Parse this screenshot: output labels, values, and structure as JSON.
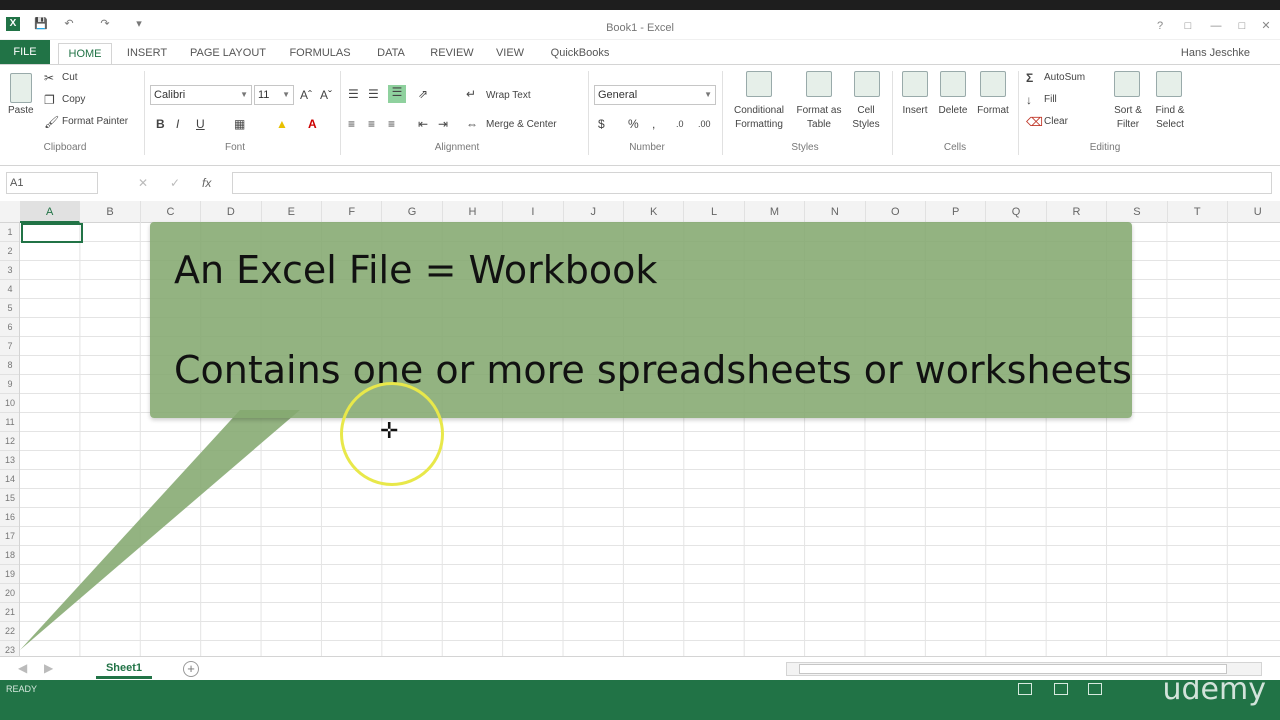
{
  "window": {
    "title": "Book1 - Excel",
    "user": "Hans Jeschke"
  },
  "tabs": [
    "FILE",
    "HOME",
    "INSERT",
    "PAGE LAYOUT",
    "FORMULAS",
    "DATA",
    "REVIEW",
    "VIEW",
    "QuickBooks"
  ],
  "ribbon": {
    "clipboard": {
      "paste": "Paste",
      "cut": "Cut",
      "copy": "Copy",
      "format_painter": "Format Painter",
      "label": "Clipboard"
    },
    "font": {
      "name": "Calibri",
      "size": "11",
      "bold": "B",
      "italic": "I",
      "underline": "U",
      "label": "Font"
    },
    "alignment": {
      "wrap_text": "Wrap Text",
      "merge_center": "Merge & Center",
      "label": "Alignment"
    },
    "number": {
      "format": "General",
      "currency": "$",
      "percent": "%",
      "label": "Number"
    },
    "styles": {
      "conditional": "Conditional",
      "conditional2": "Formatting",
      "format_as": "Format as",
      "format_as2": "Table",
      "cell": "Cell",
      "cell2": "Styles",
      "label": "Styles"
    },
    "cells": {
      "insert": "Insert",
      "delete": "Delete",
      "format": "Format",
      "label": "Cells"
    },
    "editing": {
      "autosum": "AutoSum",
      "fill": "Fill",
      "clear": "Clear",
      "sort": "Sort &",
      "sort2": "Filter",
      "find": "Find &",
      "find2": "Select",
      "label": "Editing"
    }
  },
  "formula_bar": {
    "namebox": "A1",
    "fx": "fx"
  },
  "columns": [
    "A",
    "B",
    "C",
    "D",
    "E",
    "F",
    "G",
    "H",
    "I",
    "J",
    "K",
    "L",
    "M",
    "N",
    "O",
    "P",
    "Q",
    "R",
    "S",
    "T",
    "U"
  ],
  "rows": [
    "1",
    "2",
    "3",
    "4",
    "5",
    "6",
    "7",
    "8",
    "9",
    "10",
    "11",
    "12",
    "13",
    "14",
    "15",
    "16",
    "17",
    "18",
    "19",
    "20",
    "21",
    "22",
    "23"
  ],
  "callout": {
    "line1": "An Excel File = Workbook",
    "line2": "Contains one or more spreadsheets or worksheets"
  },
  "sheets": {
    "active": "Sheet1"
  },
  "status": {
    "ready": "READY",
    "watermark": "udemy"
  }
}
